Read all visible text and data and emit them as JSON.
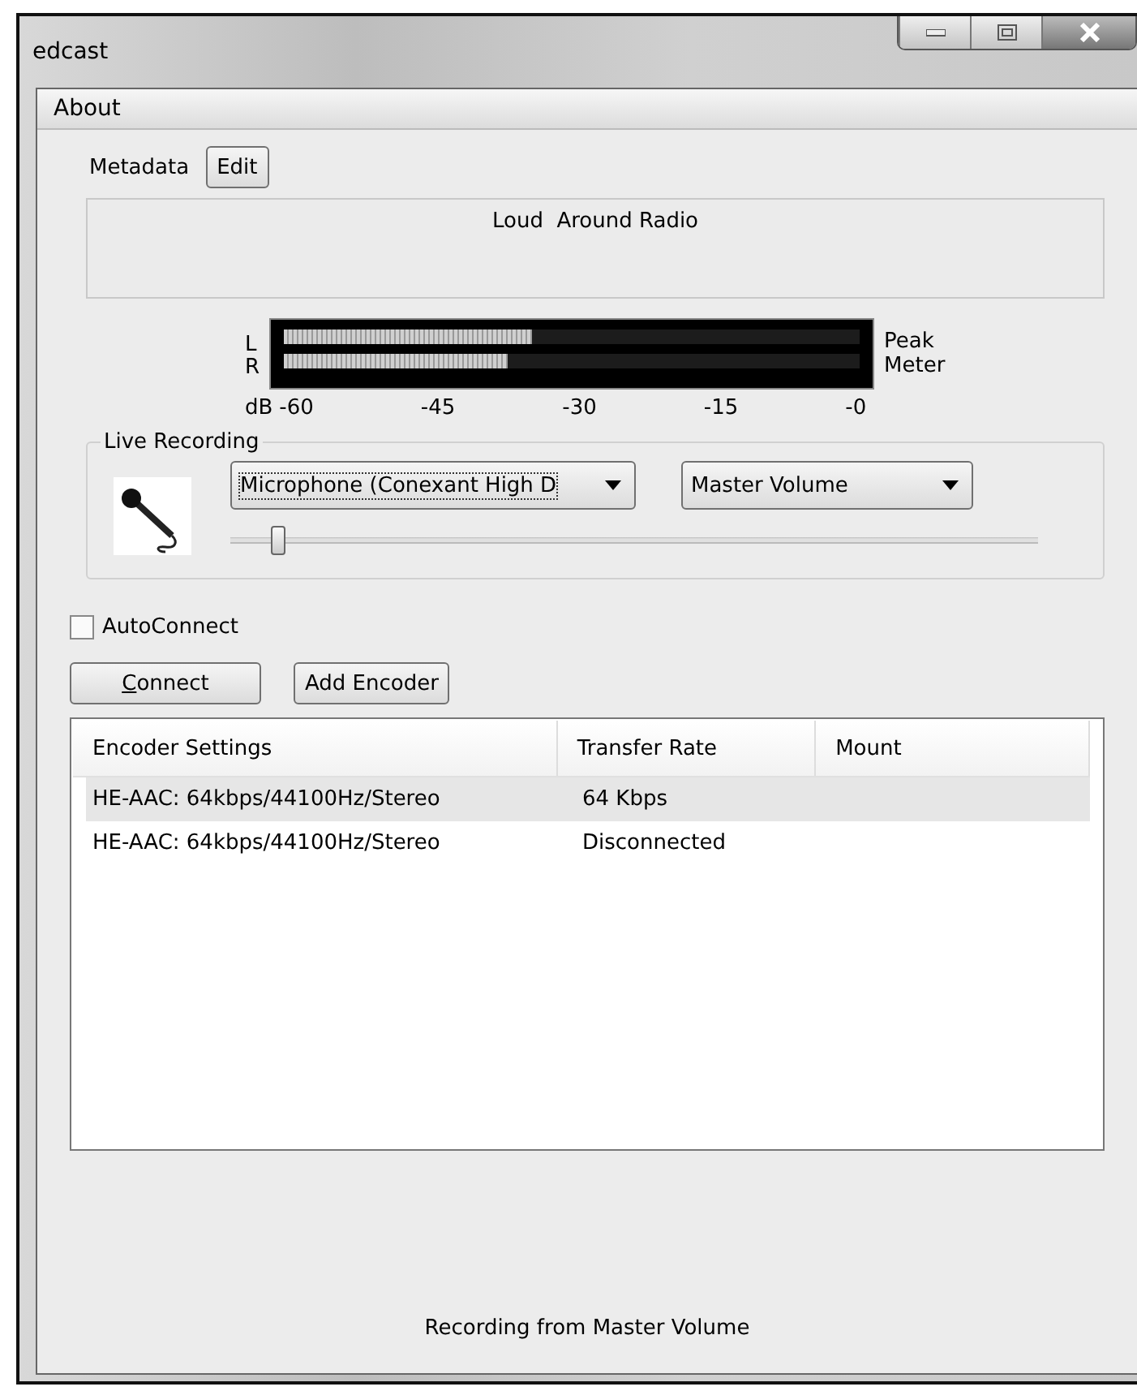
{
  "window": {
    "title": "edcast"
  },
  "menu": [
    "About"
  ],
  "metadata": {
    "label": "Metadata",
    "button": "Edit",
    "value": "Loud  Around Radio"
  },
  "meter": {
    "channels": [
      {
        "name": "L",
        "level": 0.43
      },
      {
        "name": "R",
        "level": 0.39
      }
    ],
    "caption": [
      "Peak",
      "Meter"
    ],
    "unit": "dB",
    "ticks": [
      "-60",
      "-45",
      "-30",
      "-15",
      "-0"
    ]
  },
  "live_recording": {
    "title": "Live Recording",
    "device": "Microphone (Conexant High D",
    "source": "Master Volume",
    "volume": {
      "level": 0.05
    }
  },
  "autoconnect": {
    "label": "AutoConnect",
    "checked": false
  },
  "buttons": [
    "Connect",
    "Add Encoder"
  ],
  "table": {
    "columns": [
      "Encoder Settings",
      "Transfer Rate",
      "Mount"
    ],
    "rows": [
      {
        "cells": [
          "HE-AAC: 64kbps/44100Hz/Stereo",
          "64 Kbps"
        ],
        "selected": true
      },
      {
        "cells": [
          "HE-AAC: 64kbps/44100Hz/Stereo",
          "Disconnected"
        ],
        "selected": false
      }
    ]
  },
  "status_bar": "Recording from Master Volume"
}
